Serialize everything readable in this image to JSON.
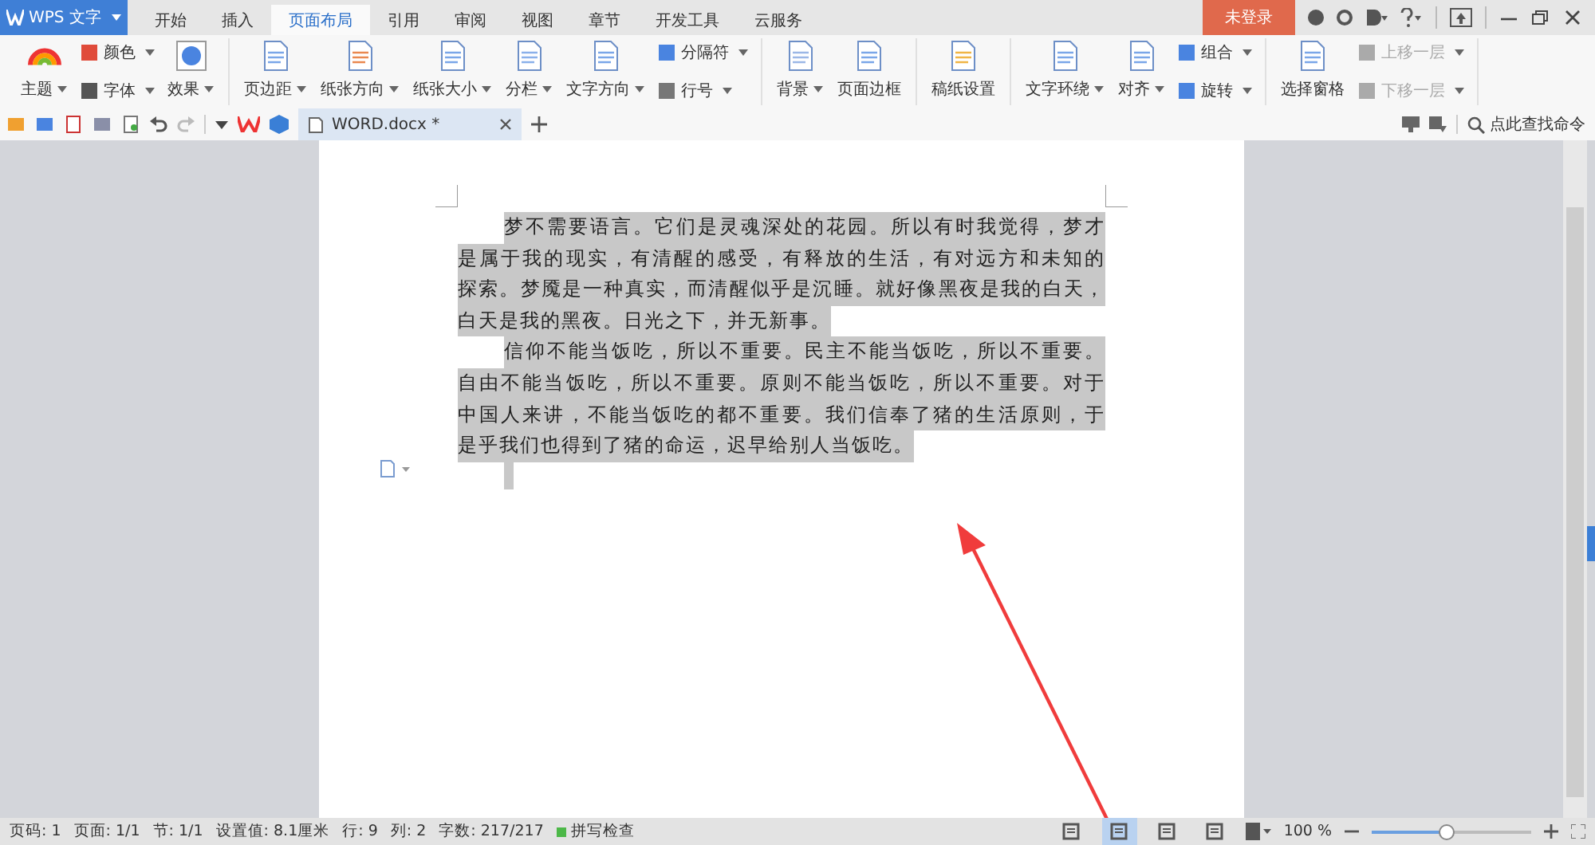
{
  "app": {
    "title": "WPS 文字"
  },
  "tabs": [
    {
      "label": "开始",
      "selected": false
    },
    {
      "label": "插入",
      "selected": false
    },
    {
      "label": "页面布局",
      "selected": true
    },
    {
      "label": "引用",
      "selected": false
    },
    {
      "label": "审阅",
      "selected": false
    },
    {
      "label": "视图",
      "selected": false
    },
    {
      "label": "章节",
      "selected": false
    },
    {
      "label": "开发工具",
      "selected": false
    },
    {
      "label": "云服务",
      "selected": false
    }
  ],
  "login_button": "未登录",
  "ribbon_groups": [
    {
      "columns": [
        {
          "kind": "large",
          "items": [
            {
              "label": "主题",
              "dropdown": true,
              "disabled": false
            }
          ]
        },
        {
          "kind": "stack",
          "items": [
            {
              "label": "颜色",
              "dropdown": true,
              "disabled": false
            },
            {
              "label": "字体",
              "dropdown": true,
              "disabled": false
            }
          ]
        },
        {
          "kind": "large",
          "items": [
            {
              "label": "效果",
              "dropdown": true,
              "disabled": false
            }
          ]
        }
      ]
    },
    {
      "columns": [
        {
          "kind": "large",
          "items": [
            {
              "label": "页边距",
              "dropdown": true,
              "disabled": false
            }
          ]
        },
        {
          "kind": "large",
          "items": [
            {
              "label": "纸张方向",
              "dropdown": true,
              "disabled": false
            }
          ]
        },
        {
          "kind": "large",
          "items": [
            {
              "label": "纸张大小",
              "dropdown": true,
              "disabled": false
            }
          ]
        },
        {
          "kind": "large",
          "items": [
            {
              "label": "分栏",
              "dropdown": true,
              "disabled": false
            }
          ]
        },
        {
          "kind": "large",
          "items": [
            {
              "label": "文字方向",
              "dropdown": true,
              "disabled": false
            }
          ]
        },
        {
          "kind": "stack",
          "items": [
            {
              "label": "分隔符",
              "dropdown": true,
              "disabled": false
            },
            {
              "label": "行号",
              "dropdown": true,
              "disabled": false
            }
          ]
        }
      ]
    },
    {
      "columns": [
        {
          "kind": "large",
          "items": [
            {
              "label": "背景",
              "dropdown": true,
              "disabled": false
            }
          ]
        },
        {
          "kind": "large",
          "items": [
            {
              "label": "页面边框",
              "dropdown": false,
              "disabled": false
            }
          ]
        }
      ]
    },
    {
      "columns": [
        {
          "kind": "large",
          "items": [
            {
              "label": "稿纸设置",
              "dropdown": false,
              "disabled": false
            }
          ]
        }
      ]
    },
    {
      "columns": [
        {
          "kind": "large",
          "items": [
            {
              "label": "文字环绕",
              "dropdown": true,
              "disabled": false
            }
          ]
        },
        {
          "kind": "large",
          "items": [
            {
              "label": "对齐",
              "dropdown": true,
              "disabled": false
            }
          ]
        },
        {
          "kind": "stack",
          "items": [
            {
              "label": "组合",
              "dropdown": true,
              "disabled": false
            },
            {
              "label": "旋转",
              "dropdown": true,
              "disabled": false
            }
          ]
        }
      ]
    },
    {
      "columns": [
        {
          "kind": "large",
          "items": [
            {
              "label": "选择窗格",
              "dropdown": false,
              "disabled": false
            }
          ]
        },
        {
          "kind": "stack",
          "items": [
            {
              "label": "上移一层",
              "dropdown": true,
              "disabled": true
            },
            {
              "label": "下移一层",
              "dropdown": true,
              "disabled": true
            }
          ]
        }
      ]
    }
  ],
  "document_tab": {
    "title": "WORD.docx *"
  },
  "command_search": {
    "placeholder": "点此查找命令"
  },
  "document": {
    "paragraphs": [
      {
        "selected": true,
        "lines": [
          "梦不需要语言。它们是灵魂深处的花园。所以有时我觉得，梦才",
          "是属于我的现实，有清醒的感受，有释放的生活，有对远方和未知的",
          "探索。梦魇是一种真实，而清醒似乎是沉睡。就好像黑夜是我的白天，",
          "白天是我的黑夜。日光之下，并无新事。"
        ]
      },
      {
        "selected": true,
        "lines": [
          "信仰不能当饭吃，所以不重要。民主不能当饭吃，所以不重要。",
          "自由不能当饭吃，所以不重要。原则不能当饭吃，所以不重要。对于",
          "中国人来讲，不能当饭吃的都不重要。我们信奉了猪的生活原则，于",
          "是乎我们也得到了猪的命运，迟早给别人当饭吃。"
        ]
      }
    ]
  },
  "status_bar": {
    "fields": [
      "页码: 1",
      "页面: 1/1",
      "节: 1/1",
      "设置值: 8.1厘米",
      "行: 9",
      "列: 2",
      "字数: 217/217"
    ],
    "spell_check": {
      "label": "拼写检查",
      "on": true
    },
    "view_buttons": [
      {
        "selected": false
      },
      {
        "selected": true
      },
      {
        "selected": false
      },
      {
        "selected": false
      }
    ],
    "zoom": {
      "reading": "100 %",
      "level": 0.47
    }
  }
}
